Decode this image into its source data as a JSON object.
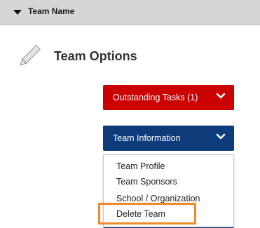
{
  "header": {
    "title": "Team Name",
    "caret_icon": "caret-down-icon"
  },
  "options": {
    "title": "Team Options",
    "icon": "pencil-icon"
  },
  "buttons": {
    "outstanding_tasks": {
      "label": "Outstanding Tasks (1)",
      "color": "#cc0000",
      "icon": "chevron-down-icon"
    },
    "team_information": {
      "label": "Team Information",
      "color": "#0e3b7a",
      "icon": "chevron-down-icon"
    }
  },
  "menu": {
    "items": [
      {
        "label": "Team Profile"
      },
      {
        "label": "Team Sponsors"
      },
      {
        "label": "School / Organization"
      },
      {
        "label": "Delete Team"
      }
    ]
  },
  "colors": {
    "highlight": "#f08a24",
    "header_bg": "#d6d6d6"
  }
}
